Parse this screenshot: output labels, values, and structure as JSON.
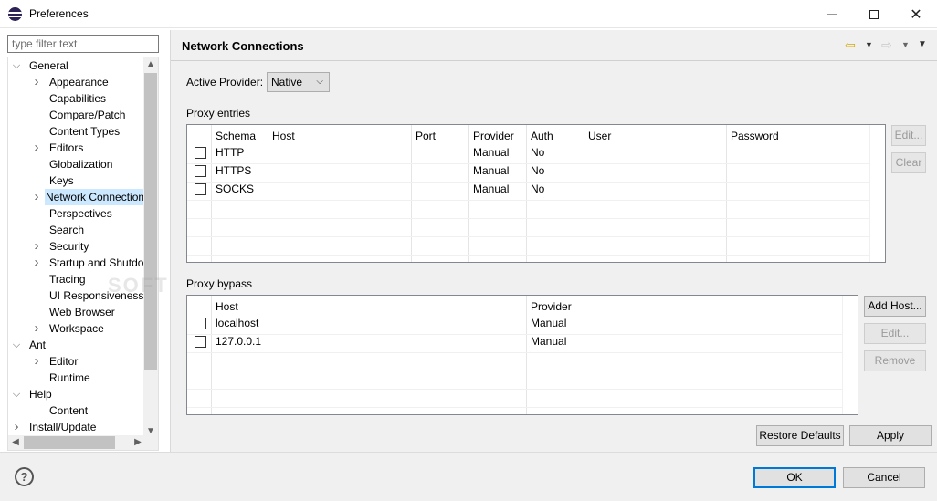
{
  "window": {
    "title": "Preferences",
    "icons": {
      "app": "eclipse-icon",
      "minimize": "minimize-icon",
      "maximize": "maximize-icon",
      "close": "close-icon"
    }
  },
  "sidebar": {
    "filter_placeholder": "type filter text",
    "tree": [
      {
        "label": "General",
        "level": 0,
        "expander": "expanded"
      },
      {
        "label": "Appearance",
        "level": 1,
        "expander": "collapsed"
      },
      {
        "label": "Capabilities",
        "level": 1,
        "expander": "none"
      },
      {
        "label": "Compare/Patch",
        "level": 1,
        "expander": "none"
      },
      {
        "label": "Content Types",
        "level": 1,
        "expander": "none"
      },
      {
        "label": "Editors",
        "level": 1,
        "expander": "collapsed"
      },
      {
        "label": "Globalization",
        "level": 1,
        "expander": "none"
      },
      {
        "label": "Keys",
        "level": 1,
        "expander": "none"
      },
      {
        "label": "Network Connections",
        "level": 1,
        "expander": "collapsed",
        "selected": true
      },
      {
        "label": "Perspectives",
        "level": 1,
        "expander": "none"
      },
      {
        "label": "Search",
        "level": 1,
        "expander": "none"
      },
      {
        "label": "Security",
        "level": 1,
        "expander": "collapsed"
      },
      {
        "label": "Startup and Shutdown",
        "level": 1,
        "expander": "collapsed"
      },
      {
        "label": "Tracing",
        "level": 1,
        "expander": "none"
      },
      {
        "label": "UI Responsiveness Monitoring",
        "level": 1,
        "expander": "none"
      },
      {
        "label": "Web Browser",
        "level": 1,
        "expander": "none"
      },
      {
        "label": "Workspace",
        "level": 1,
        "expander": "collapsed"
      },
      {
        "label": "Ant",
        "level": 0,
        "expander": "expanded"
      },
      {
        "label": "Editor",
        "level": 1,
        "expander": "collapsed"
      },
      {
        "label": "Runtime",
        "level": 1,
        "expander": "none"
      },
      {
        "label": "Help",
        "level": 0,
        "expander": "expanded"
      },
      {
        "label": "Content",
        "level": 1,
        "expander": "none"
      },
      {
        "label": "Install/Update",
        "level": 0,
        "expander": "collapsed"
      }
    ]
  },
  "page": {
    "title": "Network Connections",
    "nav_icons": [
      "back-arrow-icon",
      "back-dropdown-icon",
      "forward-arrow-icon",
      "forward-dropdown-icon",
      "view-menu-icon"
    ],
    "active_provider_label": "Active Provider:",
    "active_provider_value": "Native",
    "proxy_entries": {
      "label": "Proxy entries",
      "columns": [
        "",
        "Schema",
        "Host",
        "Port",
        "Provider",
        "Auth",
        "User",
        "Password"
      ],
      "rows": [
        {
          "checked": false,
          "cells": [
            "HTTP",
            "",
            "",
            "Manual",
            "No",
            "",
            ""
          ]
        },
        {
          "checked": false,
          "cells": [
            "HTTPS",
            "",
            "",
            "Manual",
            "No",
            "",
            ""
          ]
        },
        {
          "checked": false,
          "cells": [
            "SOCKS",
            "",
            "",
            "Manual",
            "No",
            "",
            ""
          ]
        }
      ],
      "buttons": {
        "edit": "Edit...",
        "clear": "Clear"
      }
    },
    "proxy_bypass": {
      "label": "Proxy bypass",
      "columns": [
        "",
        "Host",
        "Provider"
      ],
      "rows": [
        {
          "checked": false,
          "cells": [
            "localhost",
            "Manual"
          ]
        },
        {
          "checked": false,
          "cells": [
            "127.0.0.1",
            "Manual"
          ]
        }
      ],
      "buttons": {
        "add_host": "Add Host...",
        "edit": "Edit...",
        "remove": "Remove"
      }
    },
    "restore_defaults": "Restore Defaults",
    "apply": "Apply"
  },
  "footer": {
    "help_icon": "help-icon",
    "help_glyph": "?",
    "ok": "OK",
    "cancel": "Cancel"
  },
  "watermark": "SOFTPEDIA"
}
